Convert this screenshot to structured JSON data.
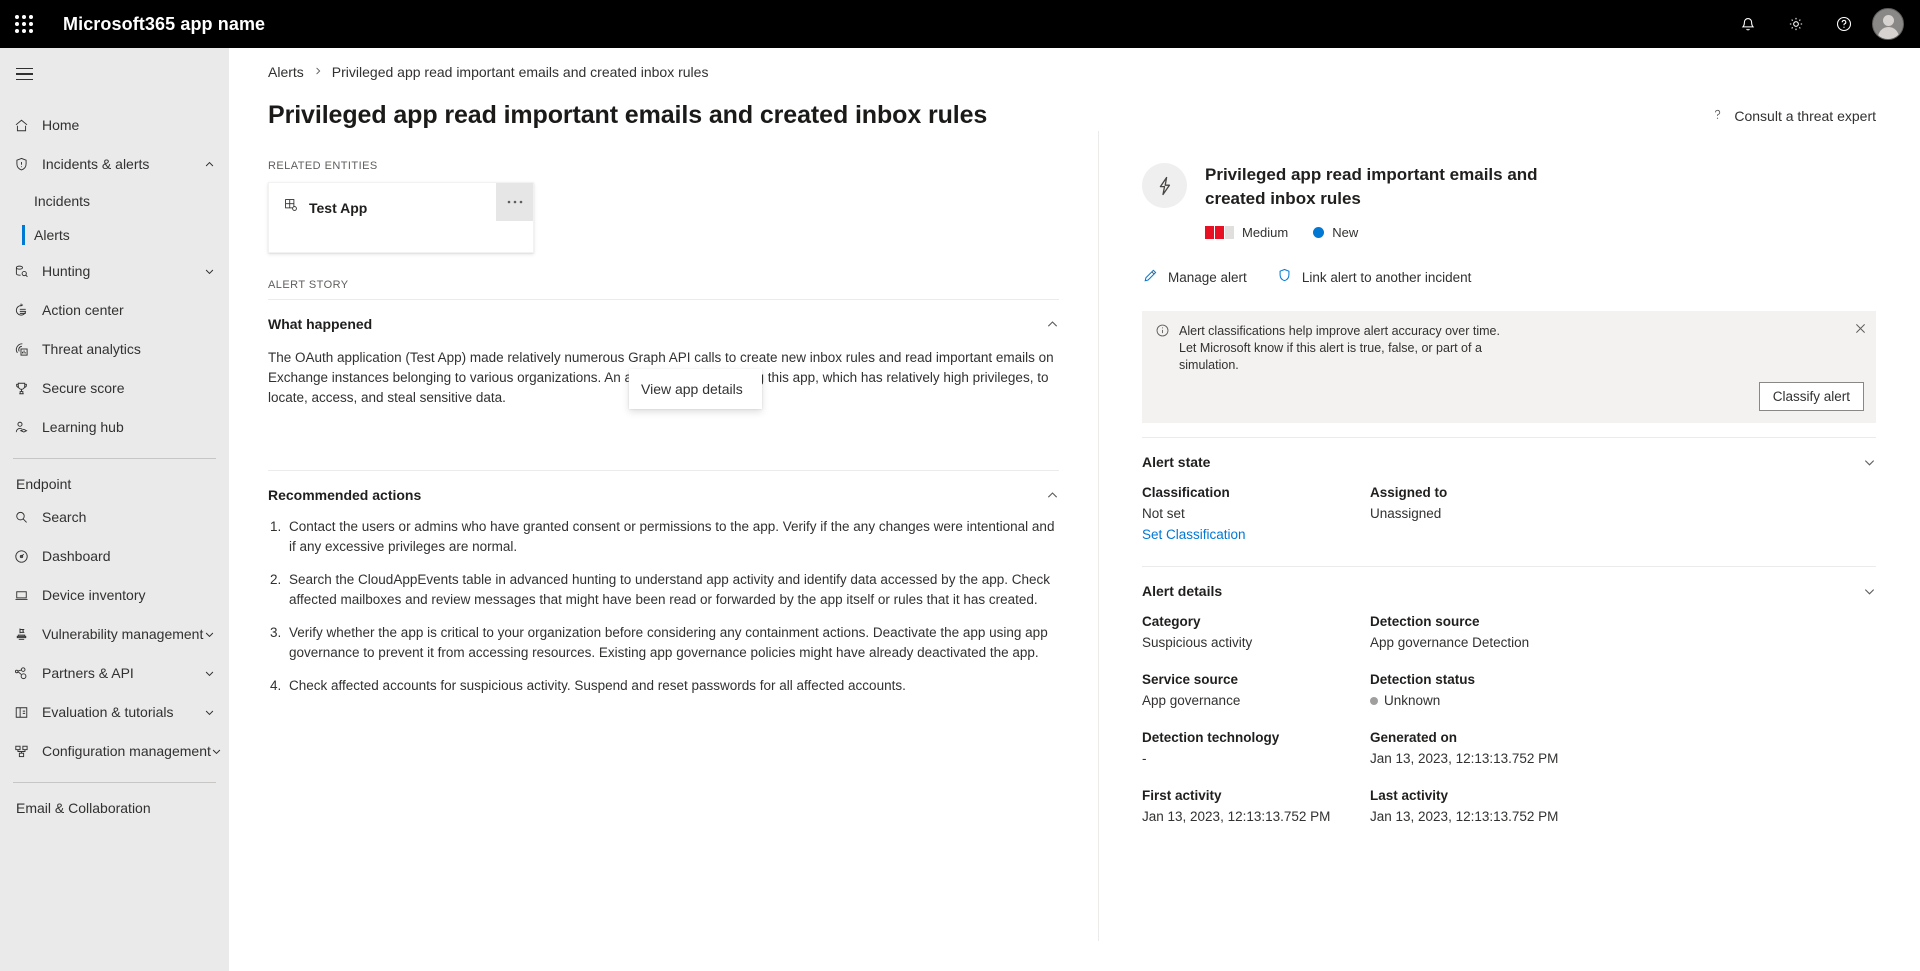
{
  "suite": {
    "waffle_icon": "app-launcher-icon",
    "title": "Microsoft365 app name",
    "icons": [
      "notification-bell-icon",
      "settings-gear-icon",
      "help-question-icon"
    ],
    "avatar": "user-avatar"
  },
  "sidebar": {
    "hamburger": "hamburger-menu-icon",
    "items": [
      {
        "label": "Home",
        "icon": "home-icon",
        "expandable": false
      },
      {
        "label": "Incidents & alerts",
        "icon": "shield-alert-icon",
        "expandable": true,
        "expanded": true
      },
      {
        "label": "Hunting",
        "icon": "hunting-icon",
        "expandable": true,
        "expanded": false
      },
      {
        "label": "Action center",
        "icon": "action-center-icon",
        "expandable": false
      },
      {
        "label": "Threat analytics",
        "icon": "threat-analytics-icon",
        "expandable": false
      },
      {
        "label": "Secure score",
        "icon": "trophy-icon",
        "expandable": false
      },
      {
        "label": "Learning hub",
        "icon": "learning-hub-icon",
        "expandable": false
      }
    ],
    "sub_items": [
      {
        "label": "Incidents",
        "selected": false
      },
      {
        "label": "Alerts",
        "selected": true
      }
    ],
    "group_endpoint": "Endpoint",
    "endpoint_items": [
      {
        "label": "Search",
        "icon": "search-icon",
        "expandable": false
      },
      {
        "label": "Dashboard",
        "icon": "dashboard-gauge-icon",
        "expandable": false
      },
      {
        "label": "Device inventory",
        "icon": "laptop-icon",
        "expandable": false
      },
      {
        "label": "Vulnerability management",
        "icon": "vulnerability-icon",
        "expandable": true
      },
      {
        "label": "Partners & API",
        "icon": "partners-api-icon",
        "expandable": true
      },
      {
        "label": "Evaluation & tutorials",
        "icon": "evaluation-tutorials-icon",
        "expandable": true
      },
      {
        "label": "Configuration management",
        "icon": "configuration-management-icon",
        "expandable": true
      }
    ],
    "group_email": "Email & Collaboration",
    "selection_color": "#0078d4"
  },
  "breadcrumb": {
    "root": "Alerts",
    "separator": "chevron-right-icon",
    "current": "Privileged app read important emails and created inbox rules"
  },
  "header": {
    "title": "Privileged app read important emails and created inbox rules",
    "consult_icon": "help-question-icon",
    "consult_label": "Consult a threat expert"
  },
  "related_entities": {
    "label": "Related entities",
    "entity": {
      "icon": "app-entity-icon",
      "name": "Test App",
      "more_icon": "ellipsis-icon",
      "more_glyph": "• • •"
    },
    "menu": {
      "items": [
        "View app details"
      ]
    }
  },
  "alert_story": {
    "label": "Alert story",
    "sections": [
      {
        "title": "What happened",
        "chevron": "chevron-up-icon",
        "text": "The OAuth application (Test App) made relatively numerous Graph API calls to create new inbox rules and read important emails on Exchange instances belonging to various organizations. An attacker might be using this app, which has relatively high privileges, to locate, access, and steal sensitive data."
      },
      {
        "title": "Recommended actions",
        "chevron": "chevron-up-icon",
        "items": [
          "Contact the users or admins who have granted consent or permissions to the app. Verify if the any changes were intentional and if any excessive privileges are normal.",
          "Search the CloudAppEvents table in advanced hunting to understand app activity and identify data accessed by the app. Check affected mailboxes and review messages that might have been read or forwarded by the app itself or rules that it has created.",
          "Verify whether the app is critical to your organization before considering any containment actions. Deactivate the app using app governance to prevent it from accessing resources. Existing app governance policies might have already deactivated the app.",
          "Check affected accounts for suspicious activity. Suspend and reset passwords for all affected accounts."
        ]
      }
    ]
  },
  "right_panel": {
    "icon": "lightning-bolt-icon",
    "title": "Privileged app read important emails and created inbox rules",
    "severity": {
      "label": "Medium",
      "filled_bars": 2,
      "total_bars": 3,
      "color": "#e81123",
      "empty_color": "#e1dfdd"
    },
    "status": {
      "label": "New",
      "dot_color": "#0078d4"
    },
    "actions": [
      {
        "label": "Manage alert",
        "icon": "pencil-edit-icon"
      },
      {
        "label": "Link alert to another incident",
        "icon": "shield-link-icon"
      }
    ],
    "notice": {
      "icon": "info-circle-icon",
      "text": "Alert classifications help improve alert accuracy over time. Let Microsoft know if this alert is true, false, or part of a simulation.",
      "button": "Classify alert",
      "close_icon": "close-x-icon"
    },
    "alert_state": {
      "title": "Alert state",
      "chevron": "chevron-down-icon",
      "fields": [
        {
          "key": "Classification",
          "value": "Not set",
          "link": "Set Classification"
        },
        {
          "key": "Assigned to",
          "value": "Unassigned",
          "link": null
        }
      ]
    },
    "alert_details": {
      "title": "Alert details",
      "chevron": "chevron-down-icon",
      "fields": [
        {
          "key": "Category",
          "value": "Suspicious activity",
          "dot": false
        },
        {
          "key": "Detection source",
          "value": "App governance Detection",
          "dot": false
        },
        {
          "key": "Service source",
          "value": "App governance",
          "dot": false
        },
        {
          "key": "Detection status",
          "value": "Unknown",
          "dot": true
        },
        {
          "key": "Detection technology",
          "value": "-",
          "dot": false
        },
        {
          "key": "Generated on",
          "value": "Jan 13, 2023, 12:13:13.752 PM",
          "dot": false
        },
        {
          "key": "First activity",
          "value": "Jan 13, 2023, 12:13:13.752 PM",
          "dot": false
        },
        {
          "key": "Last activity",
          "value": "Jan 13, 2023, 12:13:13.752 PM",
          "dot": false
        }
      ]
    }
  }
}
